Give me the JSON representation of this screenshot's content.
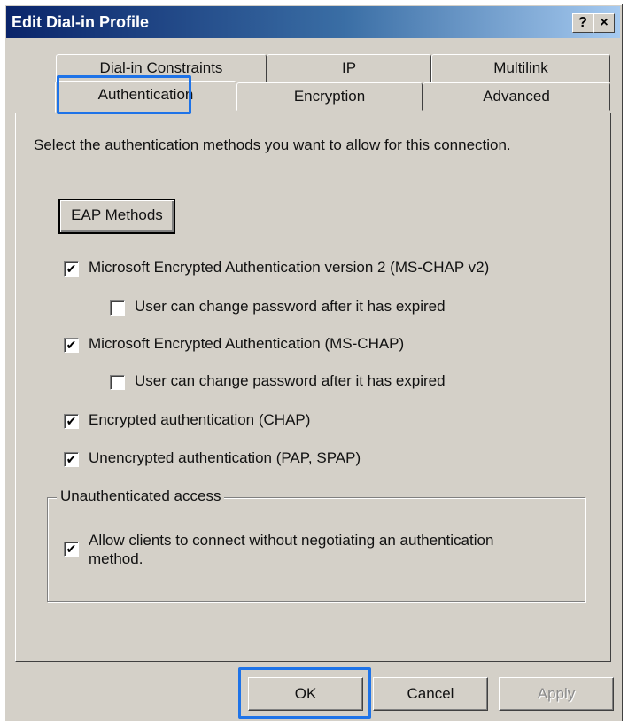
{
  "window": {
    "title": "Edit Dial-in Profile",
    "help_btn": "?",
    "close_btn": "×"
  },
  "tabs": {
    "row_back": [
      "Dial-in Constraints",
      "IP",
      "Multilink"
    ],
    "row_front": [
      "Authentication",
      "Encryption",
      "Advanced"
    ],
    "active": "Authentication"
  },
  "panel": {
    "instruction": "Select the authentication methods you want to allow for this connection.",
    "eap_button": "EAP Methods",
    "options": [
      {
        "label": "Microsoft Encrypted Authentication version 2 (MS-CHAP v2)",
        "checked": true
      },
      {
        "label": "User can change password after it has expired",
        "checked": false
      },
      {
        "label": "Microsoft Encrypted Authentication (MS-CHAP)",
        "checked": true
      },
      {
        "label": "User can change password after it has expired",
        "checked": false
      },
      {
        "label": "Encrypted authentication (CHAP)",
        "checked": true
      },
      {
        "label": "Unencrypted authentication (PAP, SPAP)",
        "checked": true
      }
    ],
    "group": {
      "title": "Unauthenticated access",
      "option_line1": "Allow clients to connect without negotiating an authentication",
      "option_line2": "method.",
      "checked": true
    }
  },
  "buttons": {
    "ok": "OK",
    "cancel": "Cancel",
    "apply": "Apply"
  },
  "colors": {
    "highlight": "#1e73e8",
    "title_bar": "#0a246a",
    "face": "#d4d0c8"
  }
}
